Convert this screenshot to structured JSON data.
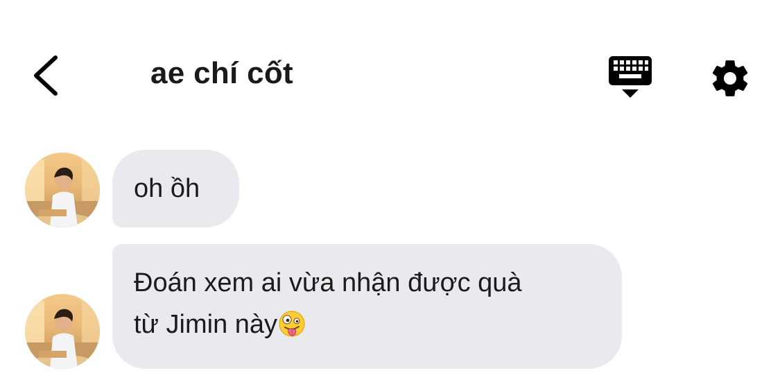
{
  "header": {
    "back_icon": "chevron-left-icon",
    "title": "ae chí cốt",
    "keyboard_icon": "keyboard-hide-icon",
    "settings_icon": "gear-icon"
  },
  "messages": [
    {
      "sender_avatar": "avatar",
      "line1": "oh ồh"
    },
    {
      "sender_avatar": "avatar",
      "line1": "Đoán xem ai vừa nhận được quà",
      "line2": "từ Jimin này",
      "emoji": "zany-face-emoji"
    }
  ],
  "colors": {
    "bubble": "#e9eaee",
    "text": "#1b1b1b",
    "icons": "#000000",
    "background": "#ffffff"
  }
}
